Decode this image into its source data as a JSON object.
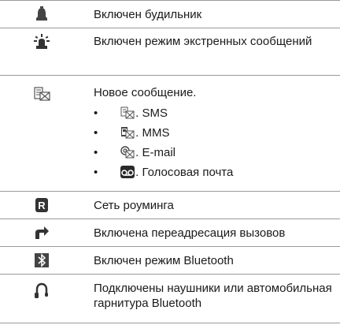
{
  "rows": [
    {
      "icon": "alarm-bell-icon",
      "text": "Включен будильник"
    },
    {
      "icon": "emergency-beacon-icon",
      "text": "Включен режим экстренных сообщений"
    },
    {
      "icon": "new-message-envelope-icon",
      "text": "Новое сообщение.",
      "items": [
        {
          "icon": "sms-icon",
          "text": ". SMS"
        },
        {
          "icon": "mms-icon",
          "text": ". MMS"
        },
        {
          "icon": "email-icon",
          "text": ". E-mail"
        },
        {
          "icon": "voicemail-icon",
          "text": ". Голосовая почта"
        }
      ]
    },
    {
      "icon": "roaming-r-icon",
      "text": "Сеть роуминга"
    },
    {
      "icon": "call-forward-arrow-icon",
      "text": "Включена переадресация вызовов"
    },
    {
      "icon": "bluetooth-icon",
      "text": "Включен режим Bluetooth"
    },
    {
      "icon": "headset-icon",
      "text": "Подключены наушники или автомобильная гарнитура Bluetooth"
    }
  ],
  "bullet_char": "•"
}
